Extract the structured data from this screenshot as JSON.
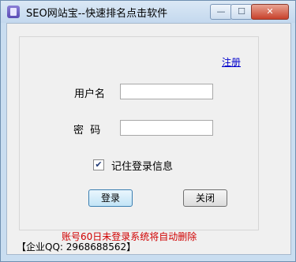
{
  "window": {
    "title": "SEO网站宝--快速排名点击软件",
    "buttons": {
      "minimize": "—",
      "maximize": "☐",
      "close": "✕"
    }
  },
  "form": {
    "register_link": "注册",
    "username_label": "用户名",
    "username_value": "",
    "password_label": "密  码",
    "password_value": "",
    "remember_label": "记住登录信息",
    "remember_checked": true,
    "login_button": "登录",
    "close_button": "关闭",
    "warning": "账号60日未登录系统将自动删除"
  },
  "footer": {
    "text": "【企业QQ: 2968688562】"
  },
  "icons": {
    "app": "app-logo-icon",
    "check": "checkmark-icon"
  }
}
